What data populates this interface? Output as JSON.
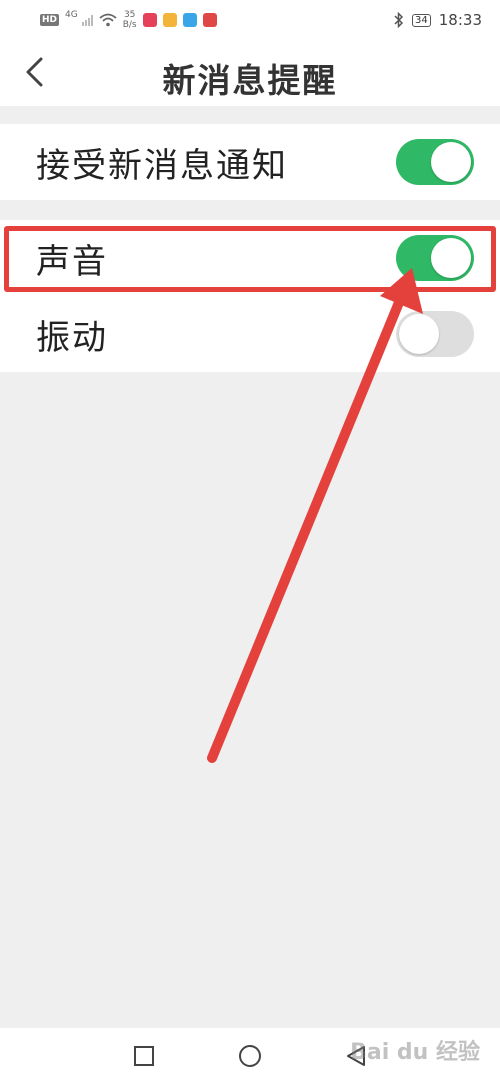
{
  "status_bar": {
    "hd": "HD",
    "network": "4G",
    "speed_top": "35",
    "speed_bottom": "B/s",
    "battery": "34",
    "time": "18:33",
    "app_icon_colors": [
      "#e6415a",
      "#f2b53a",
      "#3aa6e8",
      "#e04848"
    ]
  },
  "header": {
    "title": "新消息提醒",
    "back_icon": "chevron-left-icon"
  },
  "settings": {
    "receive_notifications": {
      "label": "接受新消息通知",
      "enabled": true
    },
    "sound": {
      "label": "声音",
      "enabled": true
    },
    "vibration": {
      "label": "振动",
      "enabled": false
    }
  },
  "colors": {
    "toggle_on": "#2fb865",
    "toggle_off": "#dedede",
    "annotation": "#e4413d"
  },
  "nav_bar": {
    "icons": [
      "square-icon",
      "circle-icon",
      "triangle-back-icon"
    ]
  },
  "watermark": "Bai du 经验"
}
